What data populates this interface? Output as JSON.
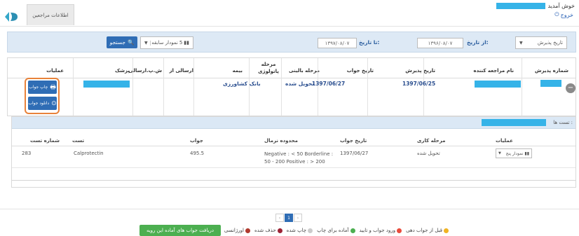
{
  "header": {
    "tab_label": "اطلاعات مراجعین",
    "welcome": "خوش آمدید",
    "logout": "خروج"
  },
  "filter": {
    "date_type": "تاریخ پذیرش",
    "from_label": "از تاریخ:",
    "from_value": "۱۳۹۶/۰۸/۰۷",
    "to_label": "تا تاریخ:",
    "to_value": "۱۳۹۷/۰۸/۰۷",
    "history_label": "نمودار سابقه",
    "history_count": "5",
    "search_label": "جستجو"
  },
  "main_table": {
    "headers": {
      "reception_no": "شماره پذیرش",
      "patient_name": "نام مراجعه کننده",
      "reception_date": "تاریخ پذیرش",
      "answer_date": "تاریخ جواب",
      "clinical_stage": "مرحله بالینی",
      "pathology_stage": "مرحله پاتولوژی",
      "insurance": "بیمه",
      "sent_from": "ارسالی از",
      "sending_id": "ش.پ.ارسالی",
      "doctor": "پزشک",
      "operations": "عملیات"
    },
    "row": {
      "reception_date": "1397/06/25",
      "answer_date": "1397/06/27",
      "clinical_stage": "تحویل شده",
      "insurance": "بانک کشاورزی"
    },
    "print_label": "چاپ جواب",
    "download_label": "دانلود جواب"
  },
  "sub_table": {
    "title": "تست ها :",
    "headers": {
      "test_no": "شماره تست",
      "test": "تست",
      "answer": "جواب",
      "normal_range": "محدوده نرمال",
      "answer_date": "تاریخ جواب",
      "work_stage": "مرحله کاری",
      "operations": "عملیات"
    },
    "row": {
      "test_no": "283",
      "test": "Calprotectin",
      "answer": "495.5",
      "normal_range": "Negative : < 50 Borderline : 50 - 200 Positive : > 200",
      "answer_date": "1397/06/27",
      "work_stage": "تحویل شده",
      "chart_label": "نمودار پنج"
    }
  },
  "footer": {
    "pages": [
      "‹",
      "1",
      "›"
    ],
    "collect_button": "دریافت جواب های آماده این رویه",
    "legend": [
      {
        "label": "قبل از جواب دهی",
        "color": "#f0b323"
      },
      {
        "label": "ورود جواب و تایید",
        "color": "#e94b3c"
      },
      {
        "label": "آماده برای چاپ",
        "color": "#4caf50"
      },
      {
        "label": "چاپ شده",
        "color": "#cccccc"
      },
      {
        "label": "حذف شده",
        "color": "#9b2335"
      },
      {
        "label": "اورژانسی",
        "color": "#b03a2e"
      }
    ]
  }
}
